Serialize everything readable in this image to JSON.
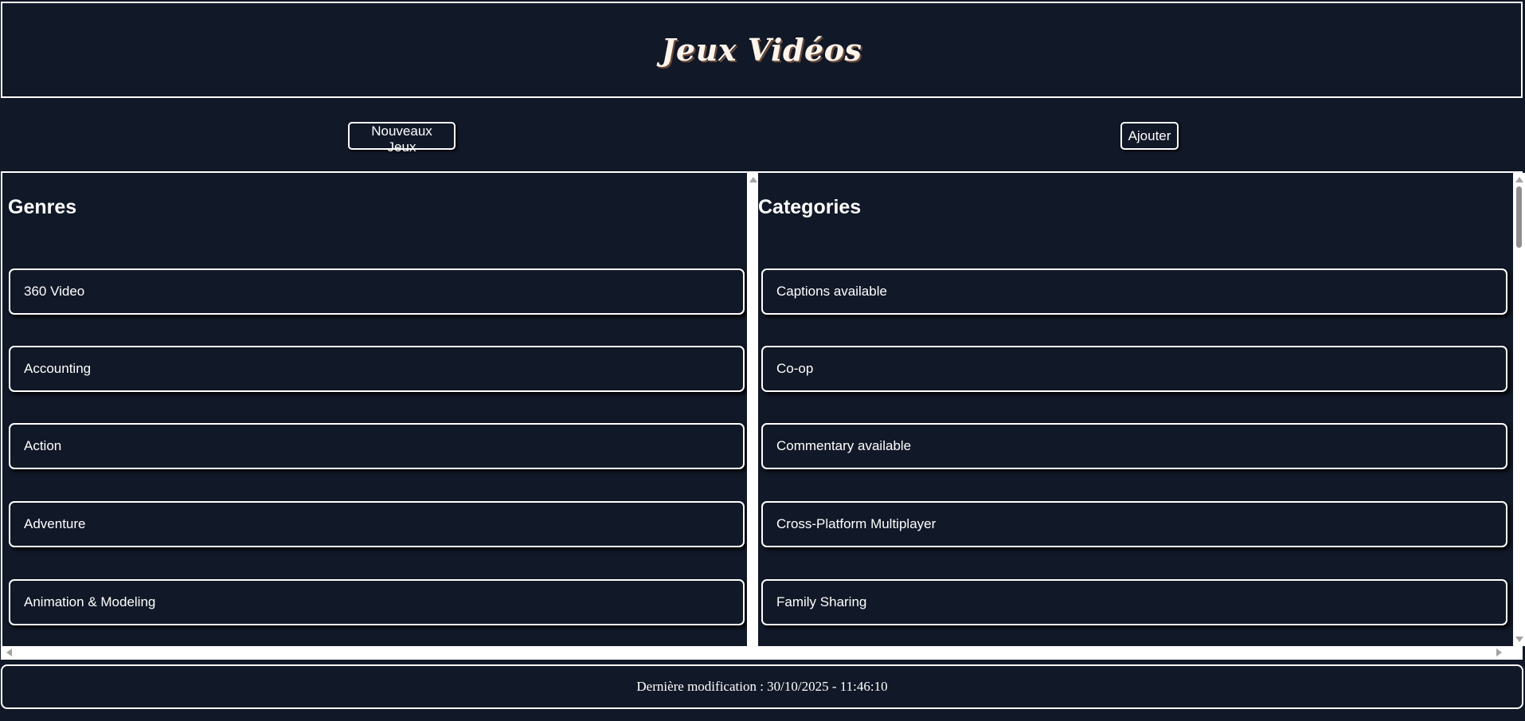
{
  "header": {
    "title": "Jeux Vidéos"
  },
  "nav": {
    "new_games_label": "Nouveaux Jeux",
    "add_label": "Ajouter"
  },
  "genres": {
    "heading": "Genres",
    "items": [
      "360 Video",
      "Accounting",
      "Action",
      "Adventure",
      "Animation & Modeling"
    ]
  },
  "categories": {
    "heading": "Categories",
    "items": [
      "Captions available",
      "Co-op",
      "Commentary available",
      "Cross-Platform Multiplayer",
      "Family Sharing"
    ]
  },
  "footer": {
    "text": "Dernière modification : 30/10/2025 - 11:46:10"
  },
  "colors": {
    "background": "#111827",
    "border": "#ffffff",
    "text": "#ffffff"
  }
}
